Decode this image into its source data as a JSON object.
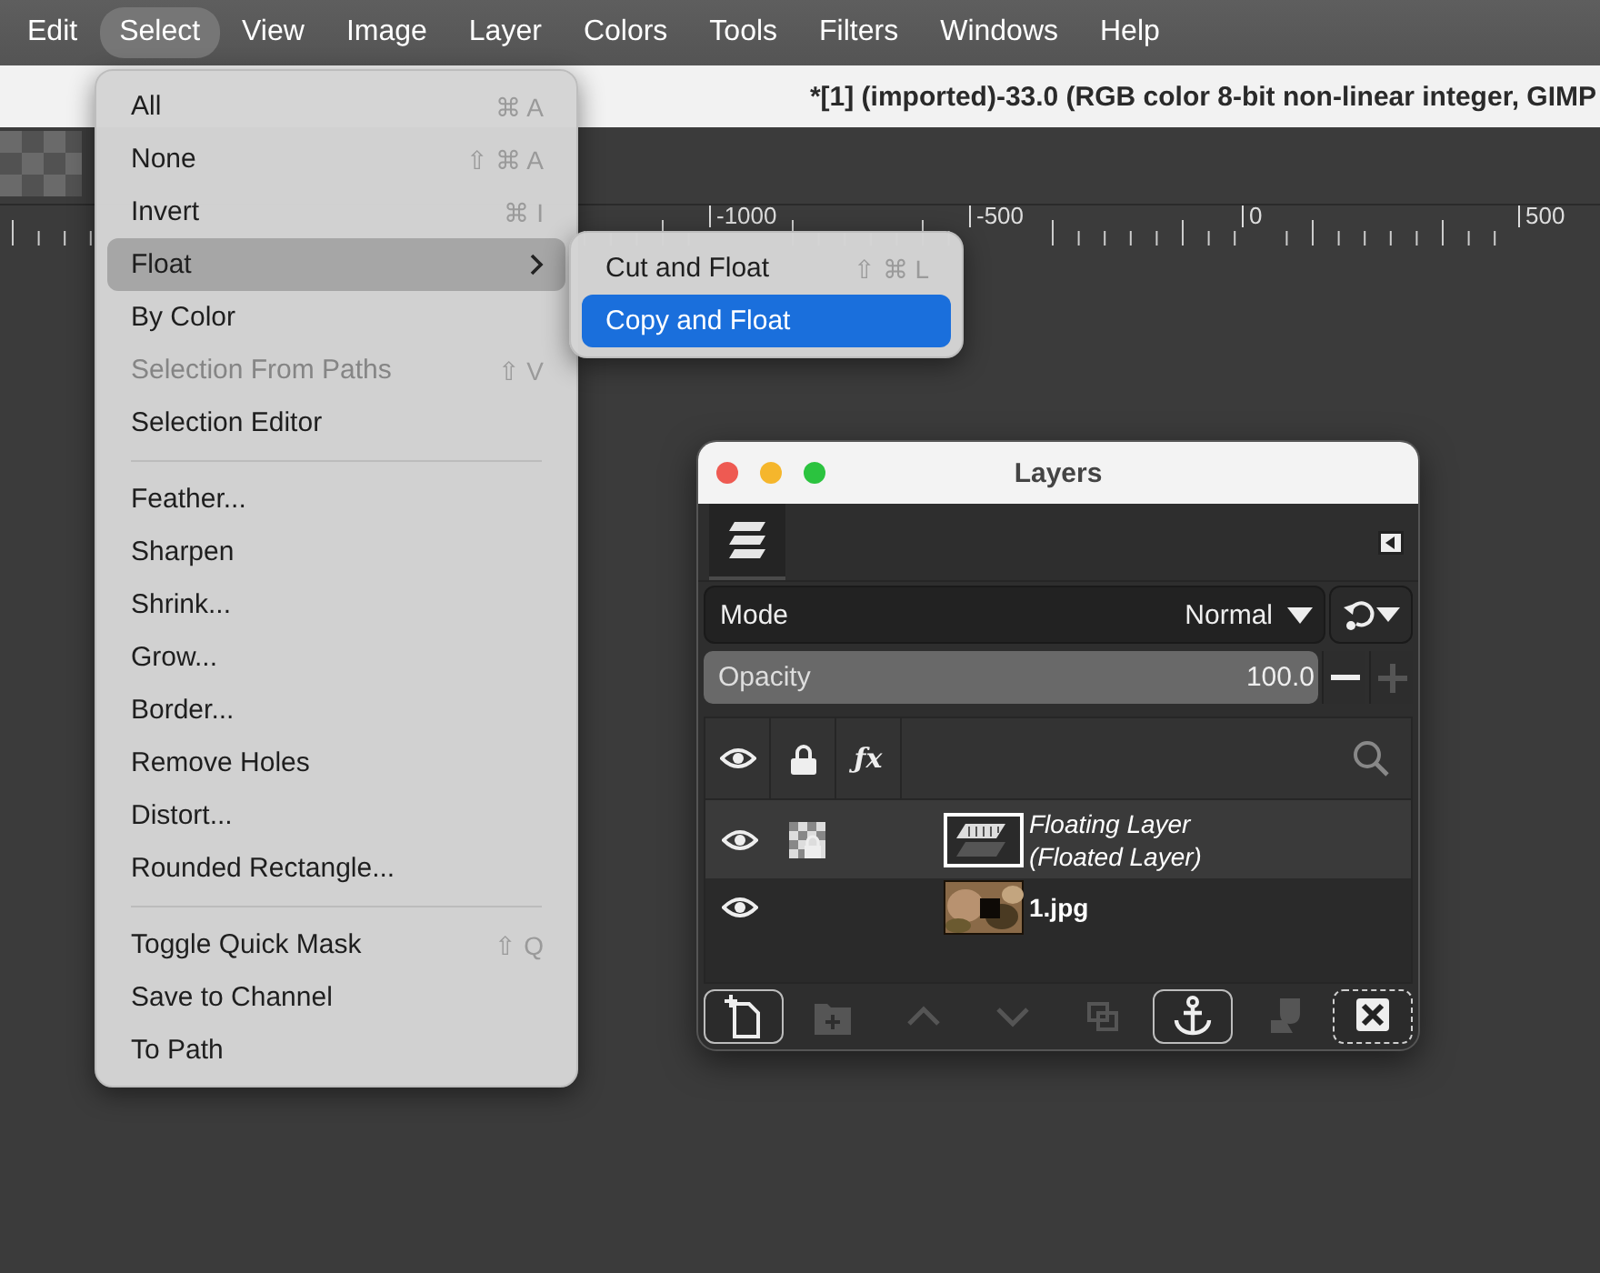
{
  "menubar": {
    "items": [
      {
        "label": "Edit",
        "selected": false
      },
      {
        "label": "Select",
        "selected": true
      },
      {
        "label": "View",
        "selected": false
      },
      {
        "label": "Image",
        "selected": false
      },
      {
        "label": "Layer",
        "selected": false
      },
      {
        "label": "Colors",
        "selected": false
      },
      {
        "label": "Tools",
        "selected": false
      },
      {
        "label": "Filters",
        "selected": false
      },
      {
        "label": "Windows",
        "selected": false
      },
      {
        "label": "Help",
        "selected": false
      }
    ]
  },
  "document_title": "*[1] (imported)-33.0 (RGB color 8-bit non-linear integer, GIMP",
  "ruler": {
    "labels": [
      "-1000",
      "-500",
      "0",
      "500"
    ]
  },
  "select_menu": {
    "items": [
      {
        "kind": "item",
        "label": "All",
        "shortcut": "⌘ A",
        "selected": false,
        "disabled": false
      },
      {
        "kind": "item",
        "label": "None",
        "shortcut": "⇧ ⌘ A",
        "selected": false,
        "disabled": false
      },
      {
        "kind": "item",
        "label": "Invert",
        "shortcut": "⌘ I",
        "selected": false,
        "disabled": false
      },
      {
        "kind": "submenu",
        "label": "Float",
        "selected": true,
        "disabled": false
      },
      {
        "kind": "item",
        "label": "By Color",
        "selected": false,
        "disabled": false
      },
      {
        "kind": "item",
        "label": "Selection From Paths",
        "shortcut": "⇧ V",
        "selected": false,
        "disabled": true
      },
      {
        "kind": "item",
        "label": "Selection Editor",
        "selected": false,
        "disabled": false
      },
      {
        "kind": "separator"
      },
      {
        "kind": "item",
        "label": "Feather...",
        "selected": false,
        "disabled": false
      },
      {
        "kind": "item",
        "label": "Sharpen",
        "selected": false,
        "disabled": false
      },
      {
        "kind": "item",
        "label": "Shrink...",
        "selected": false,
        "disabled": false
      },
      {
        "kind": "item",
        "label": "Grow...",
        "selected": false,
        "disabled": false
      },
      {
        "kind": "item",
        "label": "Border...",
        "selected": false,
        "disabled": false
      },
      {
        "kind": "item",
        "label": "Remove Holes",
        "selected": false,
        "disabled": false
      },
      {
        "kind": "item",
        "label": "Distort...",
        "selected": false,
        "disabled": false
      },
      {
        "kind": "item",
        "label": "Rounded Rectangle...",
        "selected": false,
        "disabled": false
      },
      {
        "kind": "separator"
      },
      {
        "kind": "item",
        "label": "Toggle Quick Mask",
        "shortcut": "⇧ Q",
        "selected": false,
        "disabled": false
      },
      {
        "kind": "item",
        "label": "Save to Channel",
        "selected": false,
        "disabled": false
      },
      {
        "kind": "item",
        "label": "To Path",
        "selected": false,
        "disabled": false
      }
    ]
  },
  "float_submenu": {
    "items": [
      {
        "label": "Cut and Float",
        "shortcut": "⇧ ⌘ L",
        "selected": false
      },
      {
        "label": "Copy and Float",
        "selected": true
      }
    ]
  },
  "layers_window": {
    "title": "Layers",
    "mode": {
      "label": "Mode",
      "value": "Normal"
    },
    "opacity": {
      "label": "Opacity",
      "value": "100.0",
      "level": 1
    },
    "effects_column": "ƒx",
    "layers": [
      {
        "kind": "floating",
        "name": "Floating Layer",
        "subtitle": "(Floated Layer)",
        "visible": true,
        "alpha_locked": true,
        "selected": true
      },
      {
        "name": "1.jpg",
        "visible": true,
        "alpha_locked": false,
        "selected": false
      }
    ],
    "buttons": [
      {
        "kind": "new-layer",
        "disabled": false,
        "focused": false
      },
      {
        "kind": "new-group",
        "disabled": true,
        "focused": false
      },
      {
        "kind": "raise",
        "disabled": true,
        "focused": false
      },
      {
        "kind": "lower",
        "disabled": true,
        "focused": false
      },
      {
        "kind": "duplicate",
        "disabled": true,
        "focused": false
      },
      {
        "kind": "anchor",
        "disabled": false,
        "focused": false
      },
      {
        "kind": "mask",
        "disabled": true,
        "focused": false
      },
      {
        "kind": "delete",
        "disabled": false,
        "focused": true
      }
    ]
  }
}
